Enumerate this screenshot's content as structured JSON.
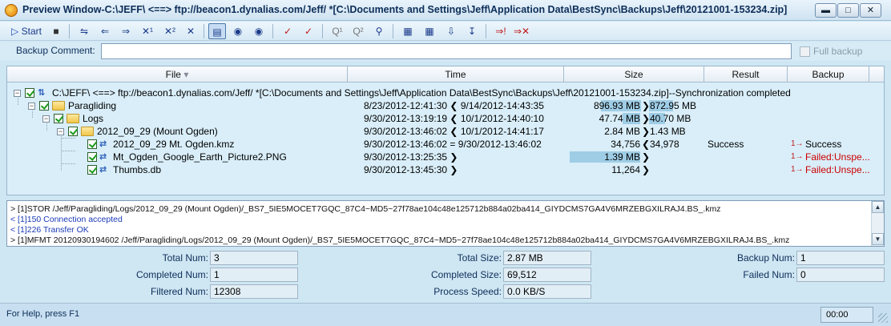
{
  "window": {
    "title": "Preview Window-C:\\JEFF\\ <==> ftp://beacon1.dynalias.com/Jeff/ *[C:\\Documents and Settings\\Jeff\\Application Data\\BestSync\\Backups\\Jeff\\20121001-153234.zip]",
    "minimize_icon": "minimize-icon",
    "maximize_icon": "maximize-icon",
    "close_icon": "close-icon"
  },
  "toolbar": {
    "start_label": "Start"
  },
  "comment": {
    "label": "Backup Comment:",
    "value": "",
    "full_backup_label": "Full backup"
  },
  "tree": {
    "columns": [
      "File",
      "Time",
      "Size",
      "Result",
      "Backup"
    ],
    "rows": [
      {
        "name": "C:\\JEFF\\ <==> ftp://beacon1.dynalias.com/Jeff/ *[C:\\Documents and Settings\\Jeff\\Application Data\\BestSync\\Backups\\Jeff\\20121001-153234.zip]--Synchronization completed",
        "time": "",
        "size_left": "",
        "size_right": "",
        "result": "",
        "backup": ""
      },
      {
        "name": "Paragliding",
        "time": "8/23/2012-12:41:30 ❮ 9/14/2012-14:43:35",
        "size_left": "896.93 MB",
        "arrow": "❯",
        "size_right": "872.95 MB",
        "result": "",
        "backup": ""
      },
      {
        "name": "Logs",
        "time": "9/30/2012-13:19:19 ❮ 10/1/2012-14:40:10",
        "size_left": "47.74 MB",
        "arrow": "❯",
        "size_right": "40.70 MB",
        "result": "",
        "backup": ""
      },
      {
        "name": "2012_09_29 (Mount Ogden)",
        "time": "9/30/2012-13:46:02 ❮ 10/1/2012-14:41:17",
        "size_left": "2.84 MB",
        "arrow": "❯",
        "size_right": "1.43 MB",
        "result": "",
        "backup": ""
      },
      {
        "name": "2012_09_29 Mt. Ogden.kmz",
        "time": "9/30/2012-13:46:02 = 9/30/2012-13:46:02",
        "size_left": "34,756",
        "arrow": "❮",
        "size_right": "34,978",
        "result": "Success",
        "backup": "Success"
      },
      {
        "name": "Mt_Ogden_Google_Earth_Picture2.PNG",
        "time": "9/30/2012-13:25:35 ❯",
        "size_left": "1.39 MB",
        "arrow": "❯",
        "size_right": "",
        "result": "",
        "backup": "Failed:Unspe..."
      },
      {
        "name": "Thumbs.db",
        "time": "9/30/2012-13:45:30 ❯",
        "size_left": "11,264",
        "arrow": "❯",
        "size_right": "",
        "result": "",
        "backup": "Failed:Unspe..."
      }
    ]
  },
  "log": {
    "lines": [
      "> [1]STOR /Jeff/Paragliding/Logs/2012_09_29 (Mount Ogden)/_BS7_5IE5MOCET7GQC_87C4~MD5~27f78ae104c48e125712b884a02ba414_GIYDCMS7GA4V6MRZEBGXILRAJ4.BS_.kmz",
      "< [1]150 Connection accepted",
      "< [1]226 Transfer OK",
      "> [1]MFMT 20120930194602 /Jeff/Paragliding/Logs/2012_09_29 (Mount Ogden)/_BS7_5IE5MOCET7GQC_87C4~MD5~27f78ae104c48e125712b884a02ba414_GIYDCMS7GA4V6MRZEBGXILRAJ4.BS_.kmz"
    ]
  },
  "stats": {
    "total_num_label": "Total Num:",
    "total_num": "3",
    "completed_num_label": "Completed Num:",
    "completed_num": "1",
    "filtered_num_label": "Filtered Num:",
    "filtered_num": "12308",
    "total_size_label": "Total Size:",
    "total_size": "2.87 MB",
    "completed_size_label": "Completed Size:",
    "completed_size": "69,512",
    "process_speed_label": "Process Speed:",
    "process_speed": "0.0 KB/S",
    "backup_num_label": "Backup Num:",
    "backup_num": "1",
    "failed_num_label": "Failed Num:",
    "failed_num": "0"
  },
  "statusbar": {
    "help_text": "For Help, press F1",
    "time": "00:00"
  }
}
